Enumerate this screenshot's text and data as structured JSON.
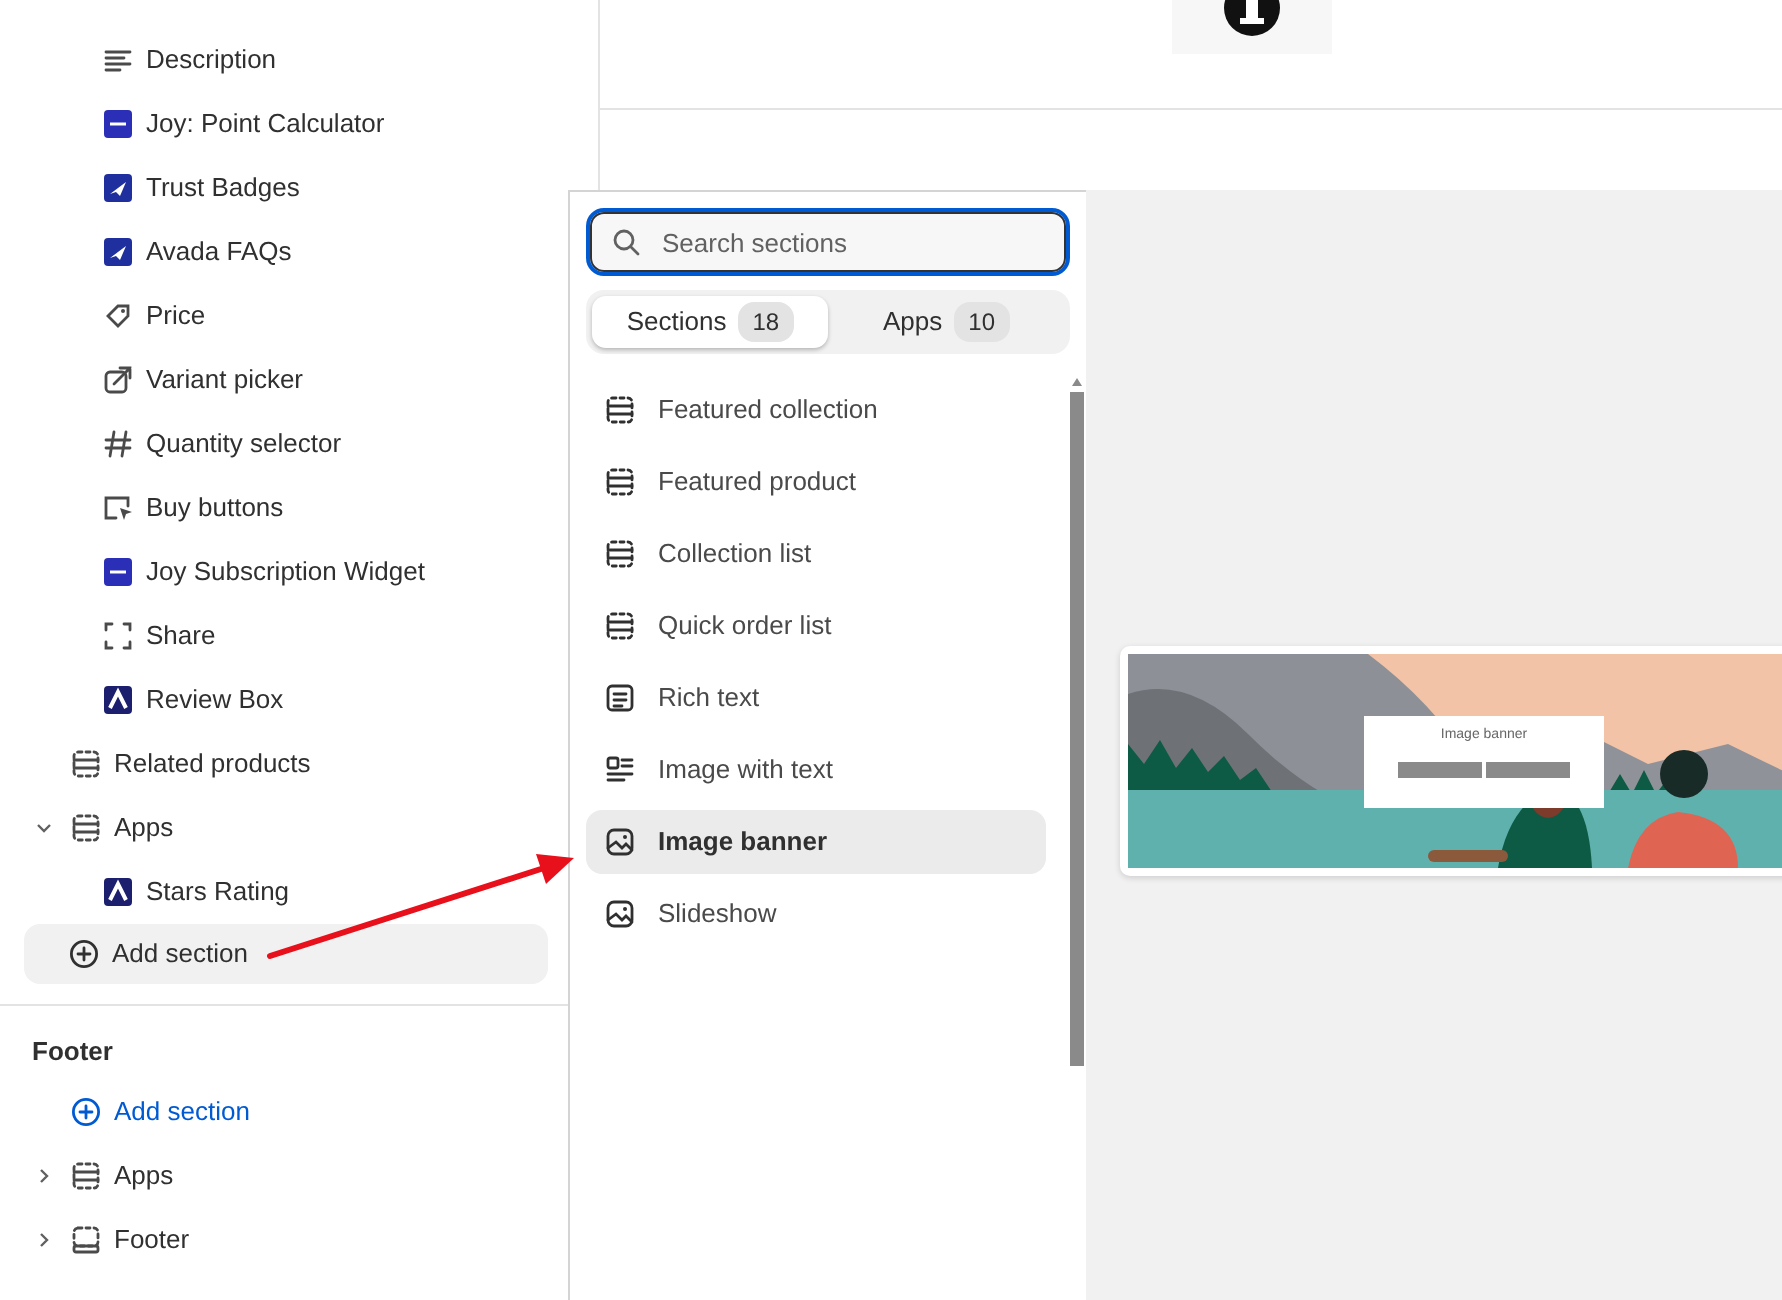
{
  "sidebar": {
    "blocks": [
      {
        "label": "Description"
      },
      {
        "label": "Joy: Point Calculator"
      },
      {
        "label": "Trust Badges"
      },
      {
        "label": "Avada FAQs"
      },
      {
        "label": "Price"
      },
      {
        "label": "Variant picker"
      },
      {
        "label": "Quantity selector"
      },
      {
        "label": "Buy buttons"
      },
      {
        "label": "Joy Subscription Widget"
      },
      {
        "label": "Share"
      },
      {
        "label": "Review Box"
      }
    ],
    "sections": [
      {
        "label": "Related products",
        "kind": "section"
      },
      {
        "label": "Apps",
        "kind": "group",
        "expanded": true,
        "children": [
          {
            "label": "Stars Rating"
          }
        ]
      }
    ],
    "add_section": {
      "label": "Add section",
      "selected": true
    },
    "footer": {
      "title": "Footer",
      "add_section": {
        "label": "Add section"
      },
      "groups": [
        {
          "label": "Apps",
          "expanded": false
        },
        {
          "label": "Footer",
          "expanded": false
        }
      ]
    }
  },
  "picker": {
    "search": {
      "placeholder": "Search sections"
    },
    "tabs": [
      {
        "label": "Sections",
        "count": "18",
        "selected": true
      },
      {
        "label": "Apps",
        "count": "10",
        "selected": false
      }
    ],
    "items": [
      {
        "label": "Featured collection",
        "selected": false
      },
      {
        "label": "Featured product",
        "selected": false
      },
      {
        "label": "Collection list",
        "selected": false
      },
      {
        "label": "Quick order list",
        "selected": false
      },
      {
        "label": "Rich text",
        "selected": false
      },
      {
        "label": "Image with text",
        "selected": false
      },
      {
        "label": "Image banner",
        "selected": true
      },
      {
        "label": "Slideshow",
        "selected": false
      }
    ]
  },
  "preview": {
    "title": "Image banner"
  }
}
